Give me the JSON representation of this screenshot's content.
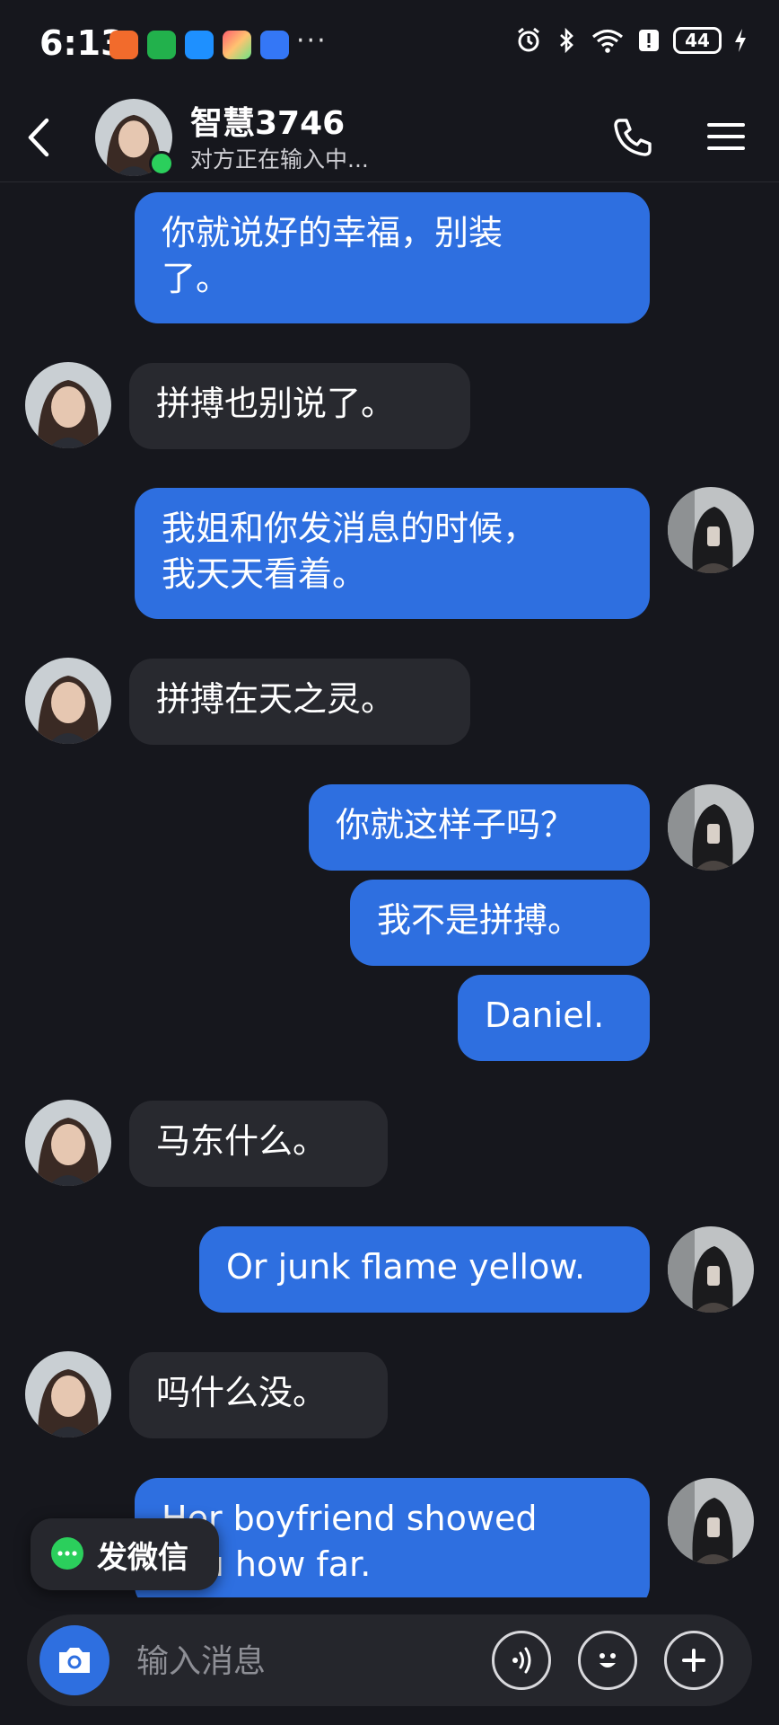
{
  "status_bar": {
    "time": "6:13",
    "more": "···",
    "battery_level": "44",
    "app_icon_colors": [
      "#f26b2c",
      "#22b14c",
      "#1e90ff",
      "#ff8a00",
      "#3477f6"
    ],
    "icons": [
      "alarm-icon",
      "bluetooth-icon",
      "wifi-icon",
      "alert-icon",
      "battery-icon",
      "charging-icon"
    ]
  },
  "header": {
    "contact_name": "智慧3746",
    "typing_status": "对方正在输入中..."
  },
  "messages": [
    {
      "direction": "out",
      "text_lines": [
        "你就说好的幸福，别装",
        "了。"
      ]
    },
    {
      "direction": "in",
      "text_lines": [
        "拼搏也别说了。"
      ]
    },
    {
      "direction": "out",
      "text_lines": [
        "我姐和你发消息的时候，",
        "我天天看着。"
      ]
    },
    {
      "direction": "in",
      "text_lines": [
        "拼搏在天之灵。"
      ]
    },
    {
      "direction": "out",
      "text_lines": [
        "你就这样子吗？"
      ]
    },
    {
      "direction": "out",
      "text_lines": [
        "我不是拼搏。"
      ]
    },
    {
      "direction": "out",
      "text_lines": [
        "Daniel."
      ]
    },
    {
      "direction": "in",
      "text_lines": [
        "马东什么。"
      ]
    },
    {
      "direction": "out",
      "text_lines": [
        "Or junk flame yellow."
      ]
    },
    {
      "direction": "in",
      "text_lines": [
        "吗什么没。"
      ]
    },
    {
      "direction": "out",
      "text_lines": [
        "Her boyfriend showed",
        "you how far."
      ]
    }
  ],
  "wechat_pill": {
    "label": "发微信"
  },
  "input": {
    "placeholder": "输入消息"
  },
  "colors": {
    "background": "#16171d",
    "outgoing_bubble": "#2e6fe0",
    "incoming_bubble": "#28292f",
    "online": "#2bcf5c",
    "wechat_green": "#2bcf5c"
  }
}
